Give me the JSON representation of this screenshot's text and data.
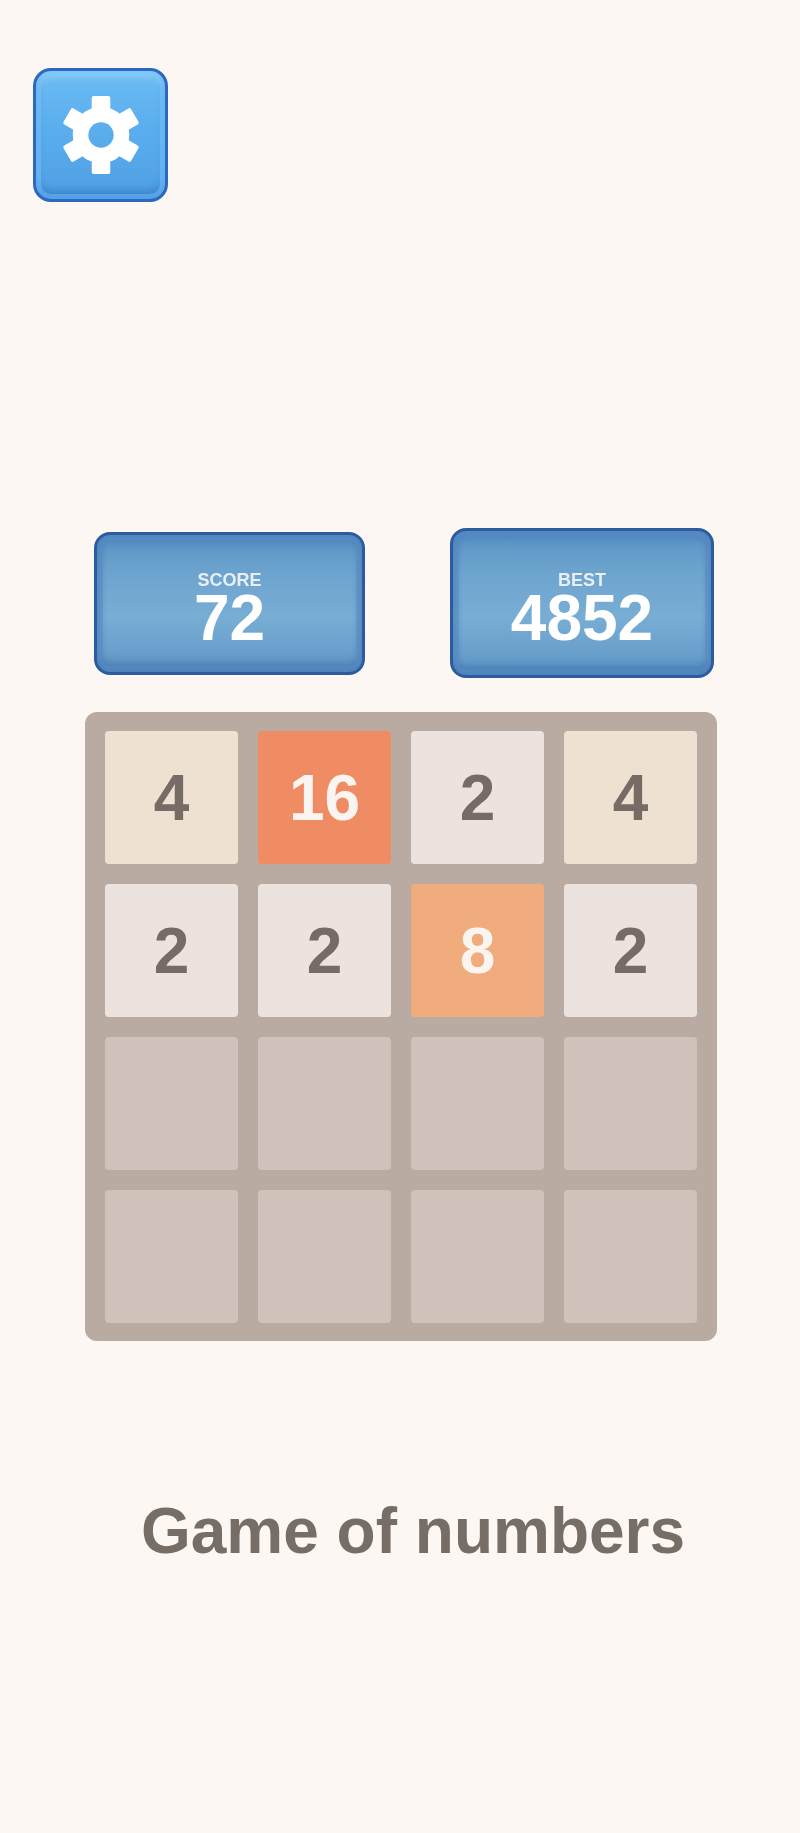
{
  "scores": [
    {
      "label": "SCORE",
      "value": "72"
    },
    {
      "label": "BEST",
      "value": "4852"
    }
  ],
  "board": {
    "rows": [
      [
        {
          "kind": "light",
          "value": "4",
          "color": "#eee1d1"
        },
        {
          "kind": "warm",
          "value": "16",
          "color": "#f08c64"
        },
        {
          "kind": "light",
          "value": "2",
          "color": "#ede3de"
        },
        {
          "kind": "light",
          "value": "4",
          "color": "#eee1d1"
        }
      ],
      [
        {
          "kind": "light",
          "value": "2",
          "color": "#ede3de"
        },
        {
          "kind": "light",
          "value": "2",
          "color": "#ede3de"
        },
        {
          "kind": "warm",
          "value": "8",
          "color": "#f0ac7c"
        },
        {
          "kind": "light",
          "value": "2",
          "color": "#ede3de"
        }
      ],
      [
        {
          "kind": "empty"
        },
        {
          "kind": "empty"
        },
        {
          "kind": "empty"
        },
        {
          "kind": "empty"
        }
      ],
      [
        {
          "kind": "empty"
        },
        {
          "kind": "empty"
        },
        {
          "kind": "empty"
        },
        {
          "kind": "empty"
        }
      ]
    ]
  },
  "title": "Game of numbers"
}
